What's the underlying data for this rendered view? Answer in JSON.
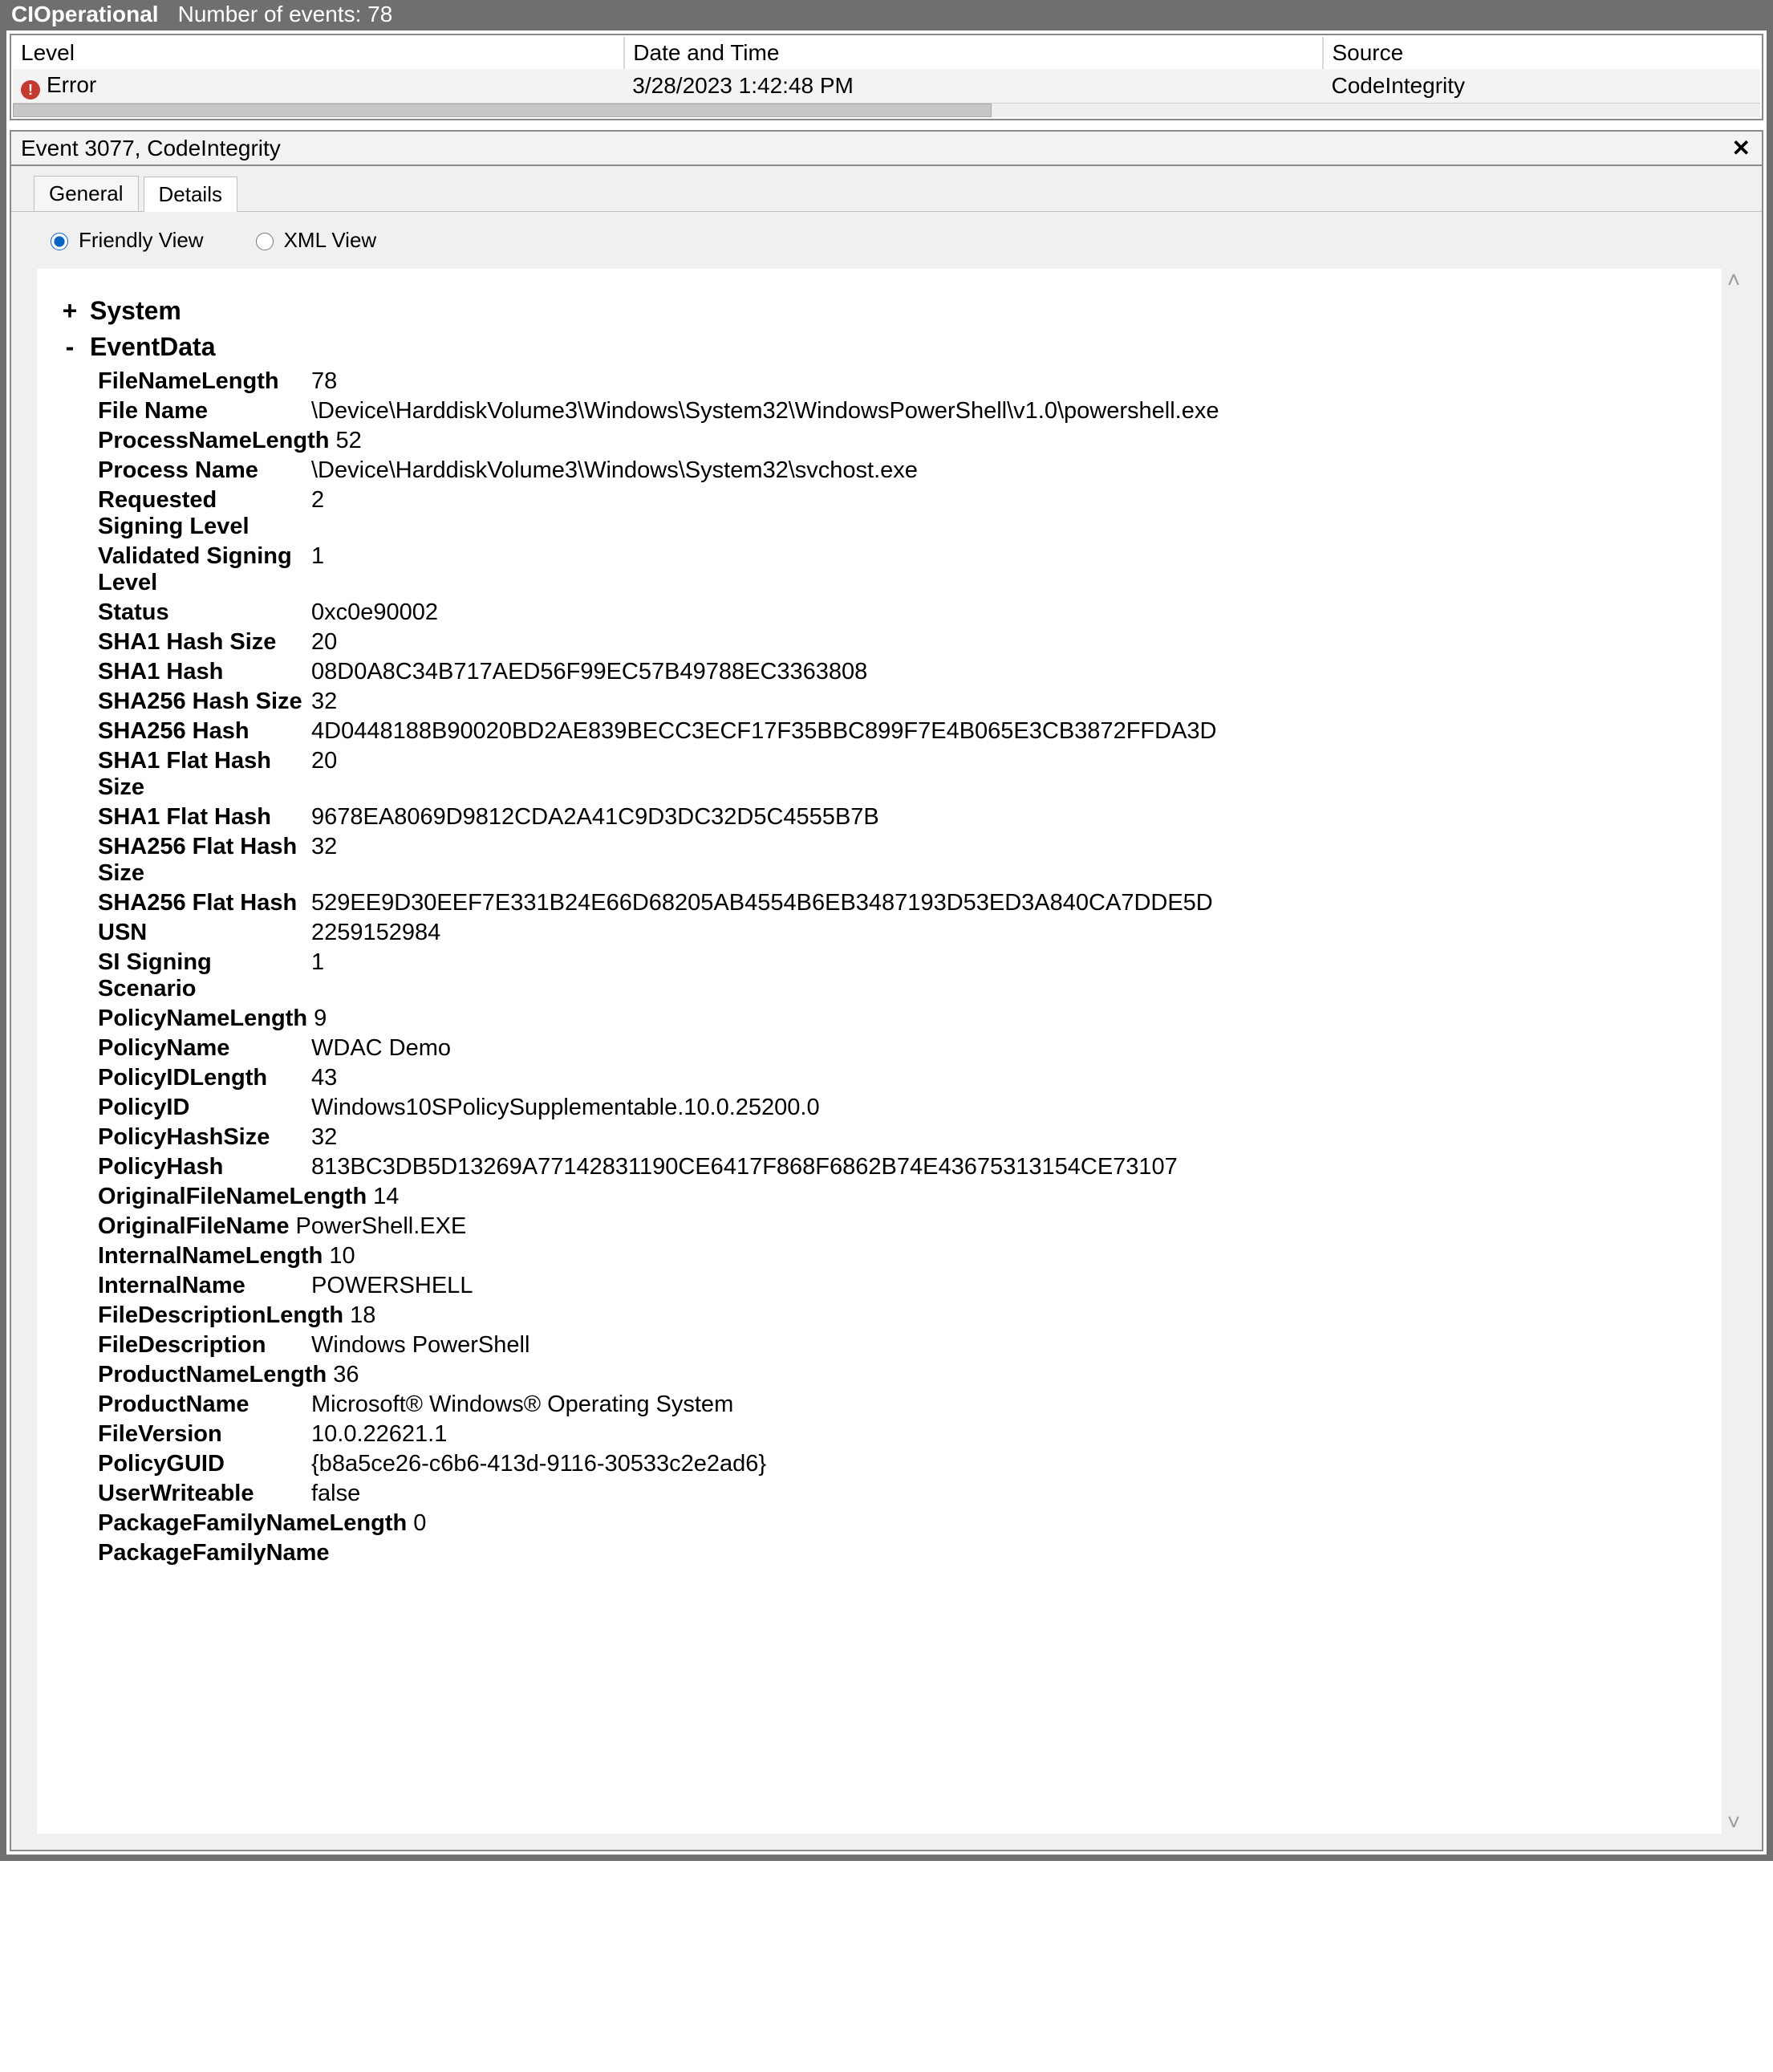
{
  "titlebar": {
    "app": "CIOperational",
    "subtitle": "Number of events: 78"
  },
  "grid": {
    "headers": {
      "level": "Level",
      "date": "Date and Time",
      "source": "Source"
    },
    "row": {
      "level": "Error",
      "date": "3/28/2023 1:42:48 PM",
      "source": "CodeIntegrity"
    }
  },
  "event": {
    "header": "Event 3077, CodeIntegrity"
  },
  "tabs": {
    "general": "General",
    "details": "Details"
  },
  "views": {
    "friendly": "Friendly View",
    "xml": "XML View"
  },
  "tree": {
    "system": {
      "label": "System",
      "collapsed": true
    },
    "eventdata": {
      "label": "EventData",
      "collapsed": false
    }
  },
  "eventdata": {
    "FileNameLength": "78",
    "FileName": "\\Device\\HarddiskVolume3\\Windows\\System32\\WindowsPowerShell\\v1.0\\powershell.exe",
    "ProcessNameLength": "52",
    "ProcessName": "\\Device\\HarddiskVolume3\\Windows\\System32\\svchost.exe",
    "RequestedSigningLevel": "2",
    "ValidatedSigningLevel": "1",
    "Status": "0xc0e90002",
    "SHA1HashSize": "20",
    "SHA1Hash": "08D0A8C34B717AED56F99EC57B49788EC3363808",
    "SHA256HashSize": "32",
    "SHA256Hash": "4D0448188B90020BD2AE839BECC3ECF17F35BBC899F7E4B065E3CB3872FFDA3D",
    "SHA1FlatHashSize": "20",
    "SHA1FlatHash": "9678EA8069D9812CDA2A41C9D3DC32D5C4555B7B",
    "SHA256FlatHashSize": "32",
    "SHA256FlatHash": "529EE9D30EEF7E331B24E66D68205AB4554B6EB3487193D53ED3A840CA7DDE5D",
    "USN": "2259152984",
    "SISigningScenario": "1",
    "PolicyNameLength": "9",
    "PolicyName": "WDAC Demo",
    "PolicyIDLength": "43",
    "PolicyID": "Windows10SPolicySupplementable.10.0.25200.0",
    "PolicyHashSize": "32",
    "PolicyHash": "813BC3DB5D13269A77142831190CE6417F868F6862B74E43675313154CE73107",
    "OriginalFileNameLength": "14",
    "OriginalFileName": "PowerShell.EXE",
    "InternalNameLength": "10",
    "InternalName": "POWERSHELL",
    "FileDescriptionLength": "18",
    "FileDescription": "Windows PowerShell",
    "ProductNameLength": "36",
    "ProductName": "Microsoft® Windows® Operating System",
    "FileVersion": "10.0.22621.1",
    "PolicyGUID": "{b8a5ce26-c6b6-413d-9116-30533c2e2ad6}",
    "UserWriteable": "false",
    "PackageFamilyNameLength": "0",
    "PackageFamilyName": ""
  },
  "labels": {
    "FileNameLength": "FileNameLength",
    "FileName": "File Name",
    "ProcessNameLength": "ProcessNameLength",
    "ProcessName": "Process Name",
    "RequestedSigningLevel": "Requested Signing Level",
    "ValidatedSigningLevel": "Validated Signing Level",
    "Status": "Status",
    "SHA1HashSize": "SHA1 Hash Size",
    "SHA1Hash": "SHA1 Hash",
    "SHA256HashSize": "SHA256 Hash Size",
    "SHA256Hash": "SHA256 Hash",
    "SHA1FlatHashSize": "SHA1 Flat Hash Size",
    "SHA1FlatHash": "SHA1 Flat Hash",
    "SHA256FlatHashSize": "SHA256 Flat Hash Size",
    "SHA256FlatHash": "SHA256 Flat Hash",
    "USN": "USN",
    "SISigningScenario": "SI Signing Scenario",
    "PolicyNameLength": "PolicyNameLength",
    "PolicyName": "PolicyName",
    "PolicyIDLength": "PolicyIDLength",
    "PolicyID": "PolicyID",
    "PolicyHashSize": "PolicyHashSize",
    "PolicyHash": "PolicyHash",
    "OriginalFileNameLength": "OriginalFileNameLength",
    "OriginalFileName": "OriginalFileName",
    "InternalNameLength": "InternalNameLength",
    "InternalName": "InternalName",
    "FileDescriptionLength": "FileDescriptionLength",
    "FileDescription": "FileDescription",
    "ProductNameLength": "ProductNameLength",
    "ProductName": "ProductName",
    "FileVersion": "FileVersion",
    "PolicyGUID": "PolicyGUID",
    "UserWriteable": "UserWriteable",
    "PackageFamilyNameLength": "PackageFamilyNameLength",
    "PackageFamilyName": "PackageFamilyName"
  }
}
